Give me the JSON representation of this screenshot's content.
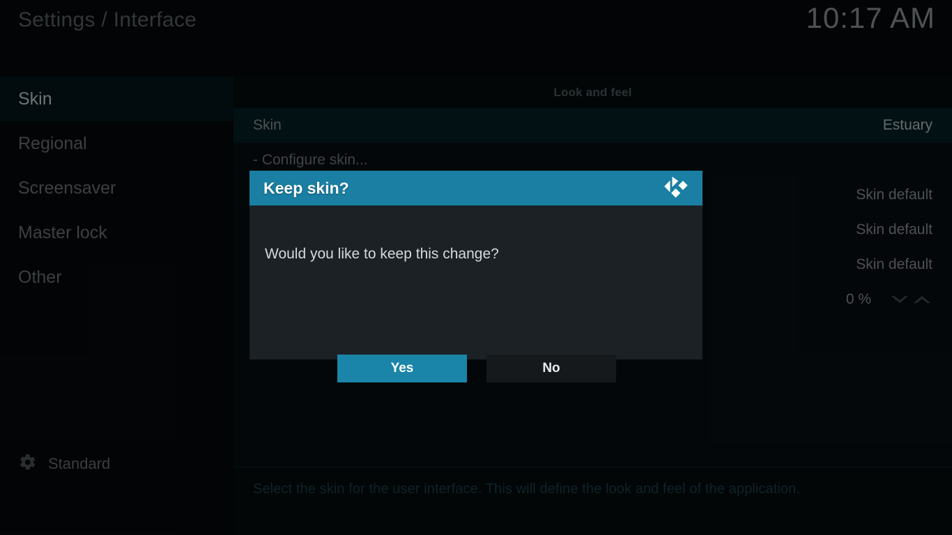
{
  "header": {
    "title": "Settings / Interface",
    "clock": "10:17 AM"
  },
  "sidebar": {
    "items": [
      {
        "label": "Skin",
        "selected": true
      },
      {
        "label": "Regional",
        "selected": false
      },
      {
        "label": "Screensaver",
        "selected": false
      },
      {
        "label": "Master lock",
        "selected": false
      },
      {
        "label": "Other",
        "selected": false
      }
    ],
    "settings_level": {
      "icon": "gear-icon",
      "label": "Standard"
    }
  },
  "main": {
    "group_header": "Look and feel",
    "rows": [
      {
        "label": "Skin",
        "value": "Estuary",
        "selected": true,
        "spinner": false
      },
      {
        "label": "- Configure skin...",
        "value": "",
        "selected": false,
        "spinner": false
      },
      {
        "label": "",
        "value": "Skin default",
        "selected": false,
        "spinner": false
      },
      {
        "label": "",
        "value": "Skin default",
        "selected": false,
        "spinner": false
      },
      {
        "label": "",
        "value": "Skin default",
        "selected": false,
        "spinner": false
      },
      {
        "label": "",
        "value": "0 %",
        "selected": false,
        "spinner": true
      }
    ],
    "description": "Select the skin for the user interface. This will define the look and feel of the application."
  },
  "dialog": {
    "title": "Keep skin?",
    "logo": "kodi-logo",
    "message": "Would you like to keep this change?",
    "buttons": [
      {
        "label": "Yes",
        "style": "primary"
      },
      {
        "label": "No",
        "style": "secondary"
      }
    ]
  },
  "colors": {
    "accent_teal": "#1a7fa2",
    "button_primary": "#1a85a8",
    "dialog_bg": "#1b2125",
    "selected_row": "#042026",
    "sidebar_selected": "#04141a",
    "main_bg": "#070e12",
    "description_text": "#1d4049"
  }
}
